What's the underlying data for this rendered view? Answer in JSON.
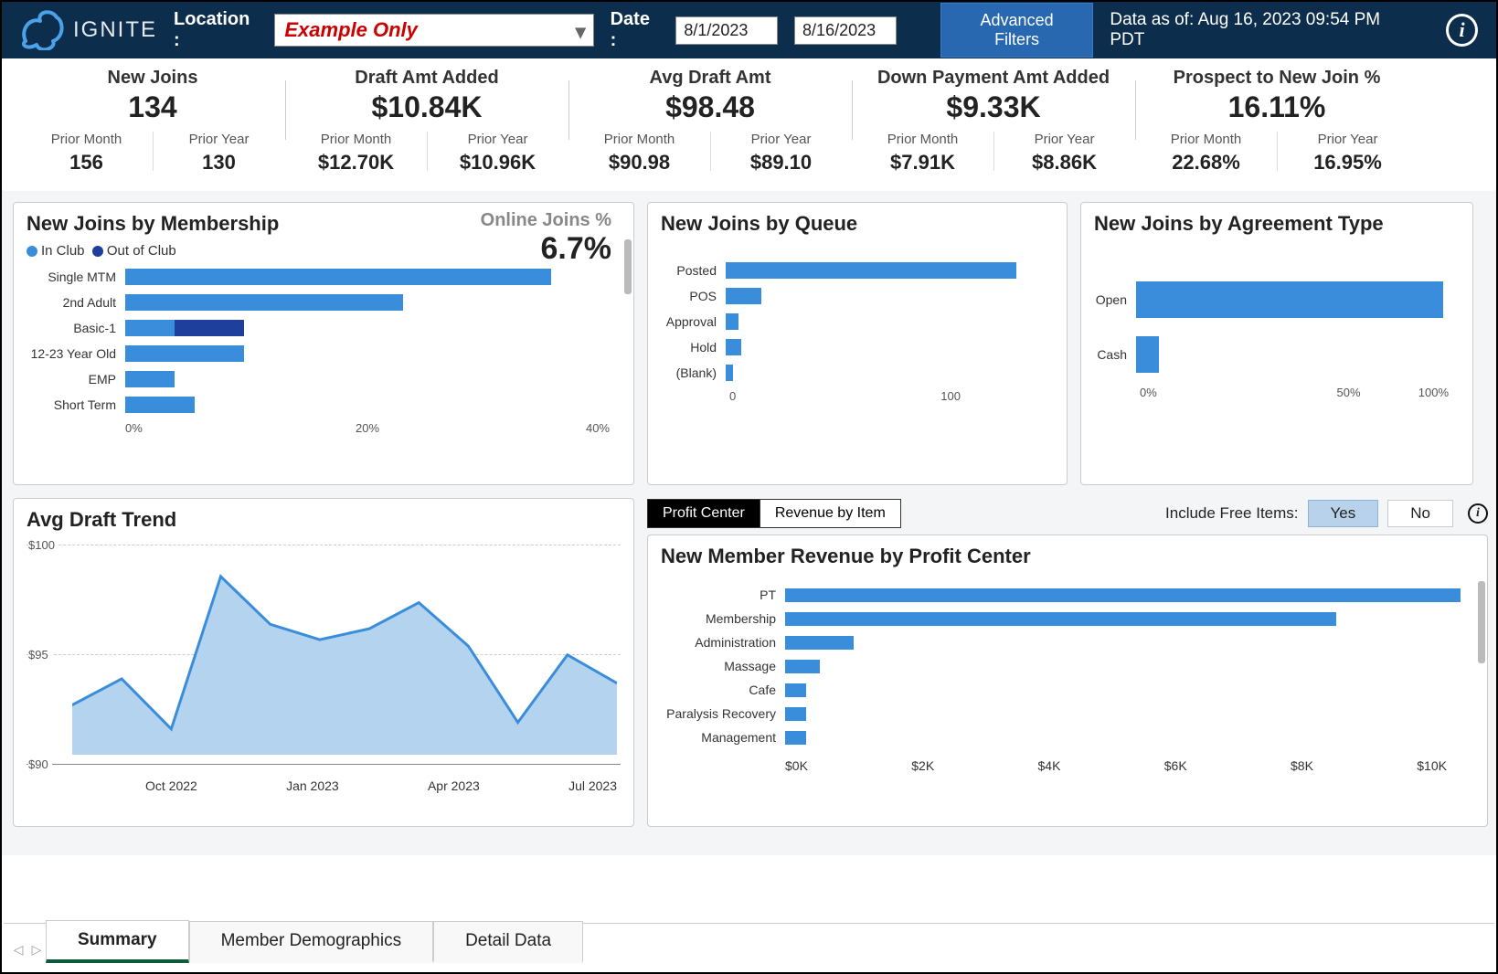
{
  "header": {
    "brand": "IGNITE",
    "location_label": "Location :",
    "location_value": "Example Only",
    "date_label": "Date :",
    "date_start": "8/1/2023",
    "date_end": "8/16/2023",
    "adv_filters": "Advanced Filters",
    "data_asof": "Data as of: Aug 16, 2023  09:54 PM PDT"
  },
  "kpis": [
    {
      "title": "New Joins",
      "main": "134",
      "pm_label": "Prior Month",
      "pm": "156",
      "py_label": "Prior Year",
      "py": "130"
    },
    {
      "title": "Draft Amt Added",
      "main": "$10.84K",
      "pm_label": "Prior Month",
      "pm": "$12.70K",
      "py_label": "Prior Year",
      "py": "$10.96K"
    },
    {
      "title": "Avg Draft Amt",
      "main": "$98.48",
      "pm_label": "Prior Month",
      "pm": "$90.98",
      "py_label": "Prior Year",
      "py": "$89.10"
    },
    {
      "title": "Down Payment Amt Added",
      "main": "$9.33K",
      "pm_label": "Prior Month",
      "pm": "$7.91K",
      "py_label": "Prior Year",
      "py": "$8.86K"
    },
    {
      "title": "Prospect to New Join %",
      "main": "16.11%",
      "pm_label": "Prior Month",
      "pm": "22.68%",
      "py_label": "Prior Year",
      "py": "16.95%"
    }
  ],
  "membership": {
    "title": "New Joins by Membership",
    "online_label": "Online Joins %",
    "online_value": "6.7%",
    "legend": {
      "in": "In Club",
      "out": "Out of Club"
    },
    "xticks": [
      "0%",
      "20%",
      "40%"
    ]
  },
  "queue": {
    "title": "New Joins by Queue",
    "xticks": [
      "0",
      "100"
    ]
  },
  "agreement": {
    "title": "New Joins by Agreement Type",
    "xticks": [
      "0%",
      "50%",
      "100%"
    ]
  },
  "avg_draft": {
    "title": "Avg Draft Trend",
    "yticks": [
      "$100",
      "$95",
      "$90"
    ],
    "xticks": [
      "Oct 2022",
      "Jan 2023",
      "Apr 2023",
      "Jul 2023"
    ]
  },
  "revenue": {
    "tab1": "Profit Center",
    "tab2": "Revenue by Item",
    "include_label": "Include Free Items:",
    "yes": "Yes",
    "no": "No",
    "title": "New Member Revenue by Profit Center",
    "xticks": [
      "$0K",
      "$2K",
      "$4K",
      "$6K",
      "$8K",
      "$10K"
    ]
  },
  "footer": {
    "tabs": [
      "Summary",
      "Member Demographics",
      "Detail Data"
    ]
  },
  "colors": {
    "primary": "#3a8ddb",
    "dark": "#1e3f9c"
  },
  "chart_data": [
    {
      "id": "new_joins_by_membership",
      "type": "bar",
      "orientation": "horizontal",
      "stacked": true,
      "categories": [
        "Single MTM",
        "2nd Adult",
        "Basic-1",
        "12-23 Year Old",
        "EMP",
        "Short Term"
      ],
      "series": [
        {
          "name": "In Club",
          "color": "#3a8ddb",
          "values": [
            43,
            28,
            5,
            12,
            5,
            7
          ]
        },
        {
          "name": "Out of Club",
          "color": "#1e3f9c",
          "values": [
            0,
            0,
            7,
            0,
            0,
            0
          ]
        }
      ],
      "xlabel": "",
      "ylabel": "",
      "xlim": [
        0,
        50
      ],
      "xticks": [
        0,
        20,
        40
      ],
      "unit": "%"
    },
    {
      "id": "new_joins_by_queue",
      "type": "bar",
      "orientation": "horizontal",
      "categories": [
        "Posted",
        "POS",
        "Approval",
        "Hold",
        "(Blank)"
      ],
      "values": [
        115,
        14,
        5,
        6,
        3
      ],
      "xlim": [
        0,
        130
      ],
      "xticks": [
        0,
        100
      ],
      "color": "#3a8ddb"
    },
    {
      "id": "new_joins_by_agreement_type",
      "type": "bar",
      "orientation": "horizontal",
      "categories": [
        "Open",
        "Cash"
      ],
      "values": [
        95,
        7
      ],
      "xlim": [
        0,
        100
      ],
      "xticks": [
        0,
        50,
        100
      ],
      "unit": "%",
      "color": "#3a8ddb"
    },
    {
      "id": "avg_draft_trend",
      "type": "area",
      "x": [
        "Aug 2022",
        "Sep 2022",
        "Oct 2022",
        "Nov 2022",
        "Dec 2022",
        "Jan 2023",
        "Feb 2023",
        "Mar 2023",
        "Apr 2023",
        "May 2023",
        "Jun 2023",
        "Jul 2023"
      ],
      "values": [
        92.3,
        93.5,
        91.2,
        98.2,
        96.0,
        95.3,
        95.8,
        97.0,
        95.0,
        91.5,
        94.6,
        93.3
      ],
      "ylim": [
        90,
        100
      ],
      "yticks": [
        90,
        95,
        100
      ],
      "xticks": [
        "Oct 2022",
        "Jan 2023",
        "Apr 2023",
        "Jul 2023"
      ],
      "color": "#3a8ddb",
      "fill": "#b4d3ee"
    },
    {
      "id": "new_member_revenue_by_profit_center",
      "type": "bar",
      "orientation": "horizontal",
      "categories": [
        "PT",
        "Membership",
        "Administration",
        "Massage",
        "Cafe",
        "Paralysis Recovery",
        "Management"
      ],
      "values": [
        9.8,
        8.0,
        1.0,
        0.5,
        0.3,
        0.3,
        0.3
      ],
      "xlim": [
        0,
        10
      ],
      "xticks": [
        0,
        2,
        4,
        6,
        8,
        10
      ],
      "unit": "$K",
      "color": "#3a8ddb"
    }
  ]
}
